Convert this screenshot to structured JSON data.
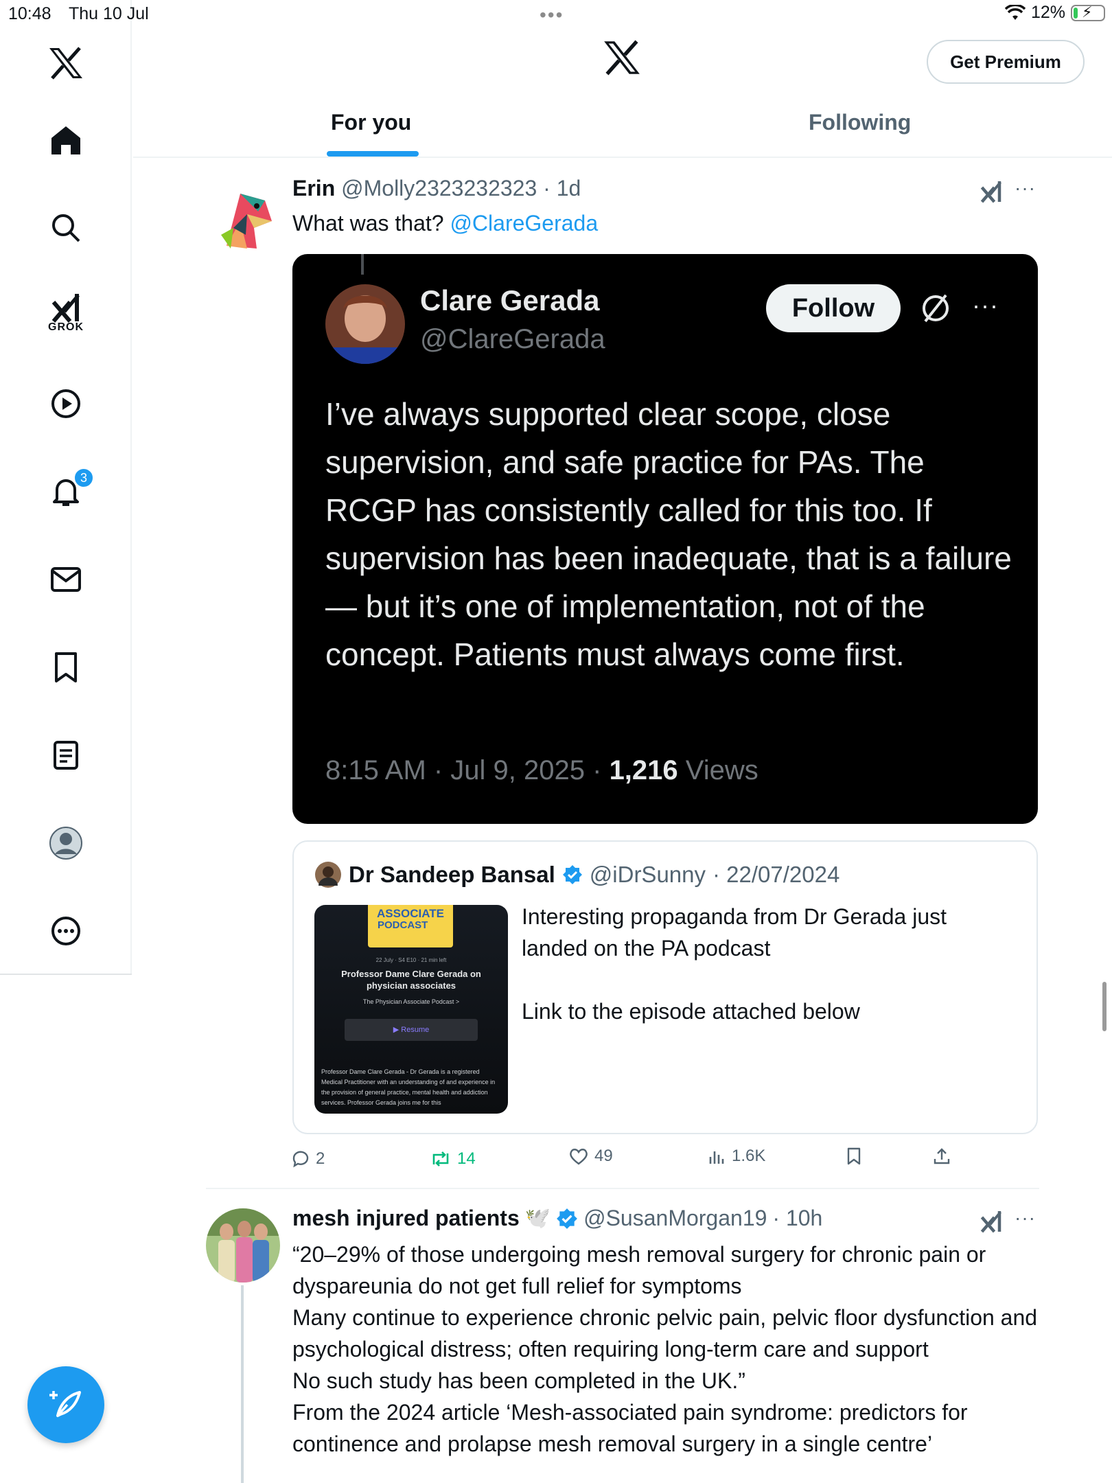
{
  "status_bar": {
    "time": "10:48",
    "date": "Thu 10 Jul",
    "battery": "12%",
    "battery_level": 0.12
  },
  "sidebar": {
    "items": [
      {
        "icon": "x-logo-icon"
      },
      {
        "icon": "home-icon"
      },
      {
        "icon": "search-icon"
      },
      {
        "icon": "grok-icon",
        "label": "GROK"
      },
      {
        "icon": "video-play-icon"
      },
      {
        "icon": "notifications-bell-icon",
        "badge": "3"
      },
      {
        "icon": "messages-envelope-icon"
      },
      {
        "icon": "bookmark-icon"
      },
      {
        "icon": "lists-icon"
      },
      {
        "icon": "profile-icon"
      },
      {
        "icon": "more-circle-icon"
      }
    ],
    "compose_icon": "compose-feather-icon"
  },
  "header": {
    "premium_label": "Get Premium",
    "tabs": [
      {
        "label": "For you",
        "active": true
      },
      {
        "label": "Following",
        "active": false
      }
    ]
  },
  "post1": {
    "name": "Erin",
    "handle": "@Molly2323232323",
    "time": "· 1d",
    "text": "What was that? ",
    "mention": "@ClareGerada",
    "embedded": {
      "name": "Clare Gerada",
      "handle": "@ClareGerada",
      "follow_label": "Follow",
      "body": "I’ve always supported clear scope, close supervision, and safe practice for PAs. The RCGP has consistently called for this too. If supervision has been inadequate, that is a failure — but it’s one of implementation, not of the concept. Patients must always come first.",
      "time": "8:15 AM · Jul 9, 2025 · ",
      "views_count": "1,216",
      "views_label": " Views"
    },
    "quote": {
      "name": "Dr Sandeep Bansal",
      "handle": "@iDrSunny",
      "date": "· 22/07/2024",
      "text_line1": "Interesting propaganda from Dr Gerada just landed on the PA podcast",
      "text_line2": "Link to the episode attached below",
      "thumb": {
        "banner_top": "ASSOCIATE",
        "banner_bottom": "PODCAST",
        "meta": "22 July · S4 E10 · 21 min left",
        "title": "Professor Dame Clare Gerada on physician associates",
        "show": "The Physician Associate Podcast >",
        "resume": "▶ Resume",
        "description": "Professor Dame Clare Gerada - Dr Gerada is a registered Medical Practitioner with an understanding of and experience in the provision of general practice, mental health and addiction services. Professor Gerada joins me for this"
      }
    },
    "actions": {
      "replies": "2",
      "reposts": "14",
      "likes": "49",
      "views": "1.6K"
    }
  },
  "post2": {
    "name": "mesh injured patients",
    "emoji": "🕊️",
    "handle": "@SusanMorgan19",
    "time": "· 10h",
    "text": "“20–29% of those undergoing mesh removal surgery for chronic pain or dyspareunia do not get full relief for symptoms\nMany continue to experience chronic pelvic pain, pelvic floor dysfunction and psychological distress; often requiring long-term care and support\nNo such study has been completed in the UK.”\nFrom the 2024 article ‘Mesh-associated pain syndrome: predictors for continence and prolapse mesh removal surgery in a single centre’"
  },
  "colors": {
    "accent": "#1d9bf0",
    "repost_green": "#00ba7c",
    "text_primary": "#0f1419",
    "text_secondary": "#536471"
  }
}
